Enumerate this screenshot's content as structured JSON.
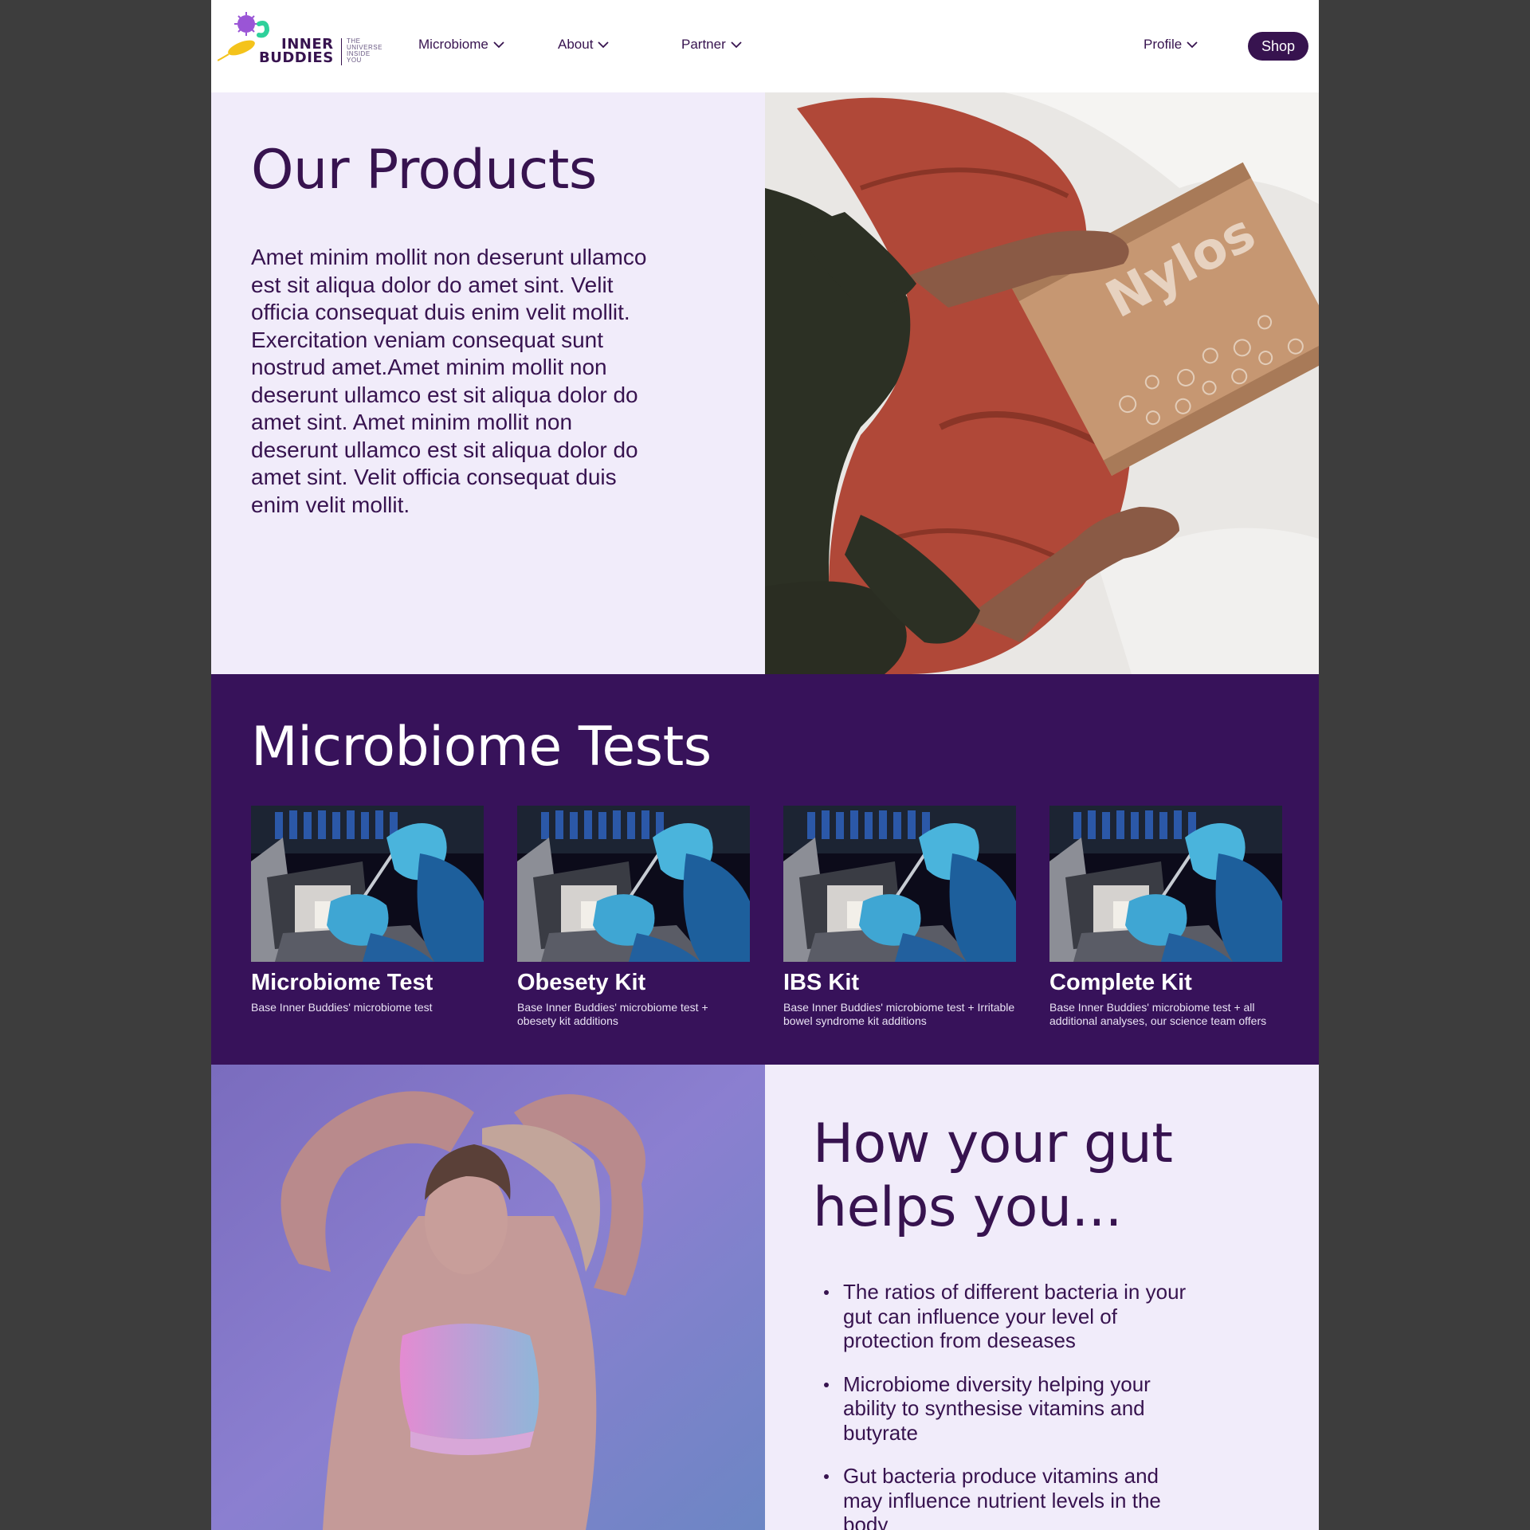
{
  "brand": {
    "line1": "INNER",
    "line2": "BUDDIES",
    "tagline": [
      "THE",
      "UNIVERSE",
      "INSIDE",
      "YOU"
    ]
  },
  "nav": {
    "microbiome": "Microbiome",
    "about": "About",
    "partner": "Partner",
    "profile": "Profile",
    "shop": "Shop"
  },
  "hero": {
    "title": "Our Products",
    "body": "Amet minim mollit non deserunt ullamco est sit aliqua dolor do amet sint. Velit officia consequat duis enim velit mollit. Exercitation veniam consequat sunt nostrud amet.Amet minim mollit non deserunt ullamco est sit aliqua dolor do amet sint. Amet minim mollit non deserunt ullamco est sit aliqua dolor do amet sint. Velit officia consequat duis enim velit mollit.",
    "box_text": "Nylos"
  },
  "tests": {
    "title": "Microbiome Tests",
    "cards": [
      {
        "title": "Microbiome Test",
        "desc": "Base Inner Buddies' microbiome test"
      },
      {
        "title": "Obesety Kit",
        "desc": "Base Inner Buddies' microbiome test + obesety kit additions"
      },
      {
        "title": "IBS Kit",
        "desc": "Base Inner Buddies' microbiome test + Irritable bowel syndrome kit additions"
      },
      {
        "title": "Complete Kit",
        "desc": "Base Inner Buddies' microbiome test + all additional analyses, our science team offers"
      }
    ]
  },
  "gut": {
    "title": "How your gut helps you...",
    "bullets": [
      "The ratios of different bacteria in your gut can influence your level of protection from deseases",
      "Microbiome diversity helping your ability to synthesise vitamins and butyrate",
      "Gut bacteria produce vitamins and may influence nutrient levels in the body"
    ]
  },
  "colors": {
    "primary": "#37134f",
    "tests_bg": "#37125a",
    "light_bg": "#f1ecfa",
    "backdrop": "#3d3d3d"
  },
  "icons": [
    "bacteria-logo-icon",
    "chevron-down-icon"
  ]
}
